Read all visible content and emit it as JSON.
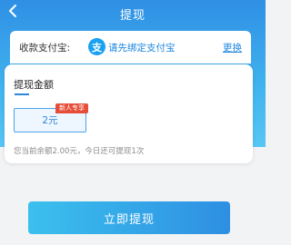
{
  "colors": {
    "header_blue": "#2f8fe4",
    "link_blue": "#1c86e0",
    "tag_red": "#e64e3a",
    "button_gradient_start": "#3bc0ee",
    "button_gradient_end": "#2e8fe2"
  },
  "nav": {
    "title": "提现",
    "back_icon": "chevron-left-icon"
  },
  "payment_account": {
    "label": "收款支付宝:",
    "logo_icon": "alipay-icon",
    "logo_glyph": "支",
    "prompt": "请先绑定支付宝",
    "change_link": "更换"
  },
  "amount_section": {
    "title": "提现金额",
    "options": [
      {
        "label": "2元",
        "tag": "新人专享",
        "selected": true
      }
    ],
    "balance_note": "您当前余额2.00元，今日还可提现1次"
  },
  "submit": {
    "label": "立即提现"
  }
}
